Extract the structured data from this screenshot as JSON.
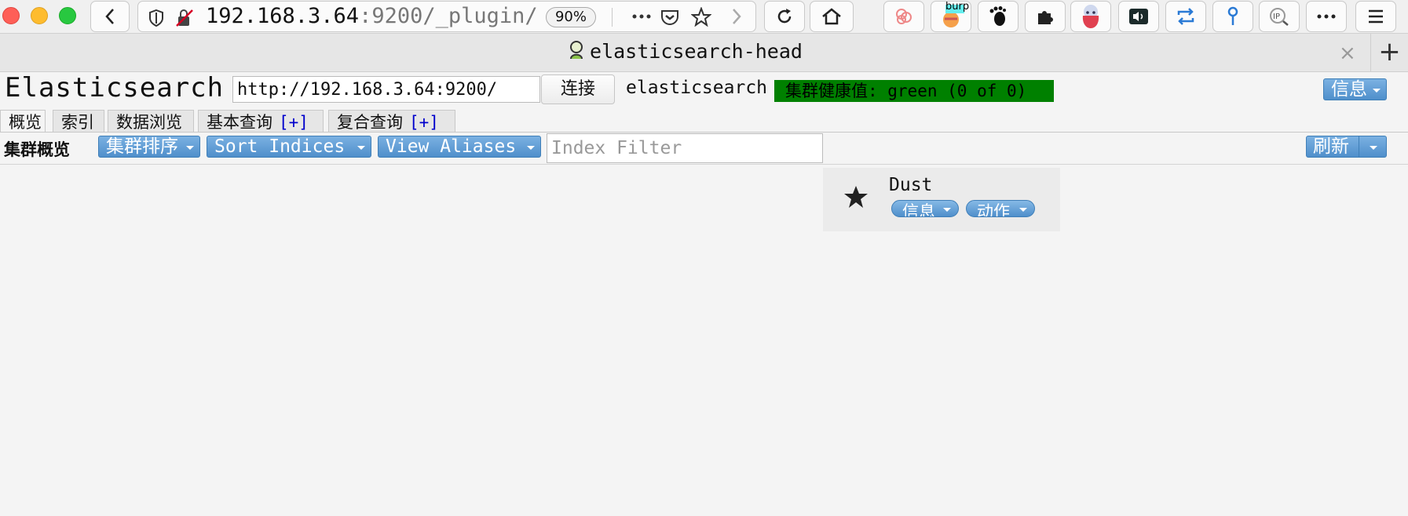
{
  "browser": {
    "url_host": "192.168.3.64",
    "url_rest": ":9200/_plugin/",
    "zoom": "90%",
    "tab_title": "elasticsearch-head",
    "tab_close": "×",
    "new_tab": "+",
    "extension_badge": "burp"
  },
  "app": {
    "title": "Elasticsearch",
    "connect_url": "http://192.168.3.64:9200/",
    "connect_label": "连接",
    "cluster_name": "elasticsearch",
    "health": "集群健康值: green (0 of 0)",
    "info_label": "信息",
    "colors": {
      "health": "#008000",
      "button": "#5b9bd5"
    }
  },
  "tabs": [
    {
      "label": "概览",
      "plus": ""
    },
    {
      "label": "索引",
      "plus": ""
    },
    {
      "label": "数据浏览",
      "plus": ""
    },
    {
      "label": "基本查询",
      "plus": "[+]"
    },
    {
      "label": "复合查询",
      "plus": "[+]"
    }
  ],
  "overview": {
    "label": "集群概览",
    "sort_cluster": "集群排序",
    "sort_indices": "Sort Indices",
    "view_aliases": "View Aliases",
    "filter_placeholder": "Index Filter",
    "refresh": "刷新"
  },
  "node": {
    "name": "Dust",
    "info": "信息",
    "action": "动作",
    "icon": "star-icon"
  }
}
